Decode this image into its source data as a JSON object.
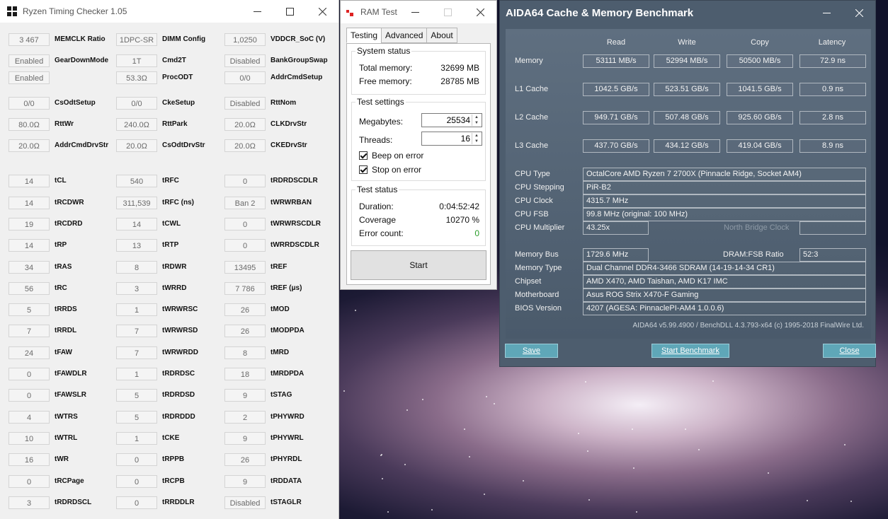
{
  "rtc": {
    "title": "Ryzen Timing Checker 1.05",
    "rows": [
      [
        "3 467",
        "MEMCLK Ratio",
        "1DPC-SR",
        "DIMM Config",
        "1,0250",
        "VDDCR_SoC (V)"
      ],
      [
        "Enabled",
        "GearDownMode",
        "1T",
        "Cmd2T",
        "Disabled",
        "BankGroupSwap"
      ],
      [
        "Enabled",
        "",
        "53.3Ω",
        "ProcODT",
        "0/0",
        "AddrCmdSetup"
      ],
      [
        "0/0",
        "CsOdtSetup",
        "0/0",
        "CkeSetup",
        "Disabled",
        "RttNom"
      ],
      [
        "80.0Ω",
        "RttWr",
        "240.0Ω",
        "RttPark",
        "20.0Ω",
        "CLKDrvStr"
      ],
      [
        "20.0Ω",
        "AddrCmdDrvStr",
        "20.0Ω",
        "CsOdtDrvStr",
        "20.0Ω",
        "CKEDrvStr"
      ],
      [
        "14",
        "tCL",
        "540",
        "tRFC",
        "0",
        "tRDRDSCDLR"
      ],
      [
        "14",
        "tRCDWR",
        "311,539",
        "tRFC (ns)",
        "Ban 2",
        "tWRWRBAN"
      ],
      [
        "19",
        "tRCDRD",
        "14",
        "tCWL",
        "0",
        "tWRWRSCDLR"
      ],
      [
        "14",
        "tRP",
        "13",
        "tRTP",
        "0",
        "tWRRDSCDLR"
      ],
      [
        "34",
        "tRAS",
        "8",
        "tRDWR",
        "13495",
        "tREF"
      ],
      [
        "56",
        "tRC",
        "3",
        "tWRRD",
        "7 786",
        "tREF (μs)"
      ],
      [
        "5",
        "tRRDS",
        "1",
        "tWRWRSC",
        "26",
        "tMOD"
      ],
      [
        "7",
        "tRRDL",
        "7",
        "tWRWRSD",
        "26",
        "tMODPDA"
      ],
      [
        "24",
        "tFAW",
        "7",
        "tWRWRDD",
        "8",
        "tMRD"
      ],
      [
        "0",
        "tFAWDLR",
        "1",
        "tRDRDSC",
        "18",
        "tMRDPDA"
      ],
      [
        "0",
        "tFAWSLR",
        "5",
        "tRDRDSD",
        "9",
        "tSTAG"
      ],
      [
        "4",
        "tWTRS",
        "5",
        "tRDRDDD",
        "2",
        "tPHYWRD"
      ],
      [
        "10",
        "tWTRL",
        "1",
        "tCKE",
        "9",
        "tPHYWRL"
      ],
      [
        "16",
        "tWR",
        "0",
        "tRPPB",
        "26",
        "tPHYRDL"
      ],
      [
        "0",
        "tRCPage",
        "0",
        "tRCPB",
        "9",
        "tRDDATA"
      ],
      [
        "3",
        "tRDRDSCL",
        "0",
        "tRRDDLR",
        "Disabled",
        "tSTAGLR"
      ]
    ]
  },
  "ramtest": {
    "title": "RAM Test",
    "tabs": [
      "Testing",
      "Advanced",
      "About"
    ],
    "system_status": {
      "title": "System status",
      "total_label": "Total memory:",
      "total_value": "32699 MB",
      "free_label": "Free memory:",
      "free_value": "28785 MB"
    },
    "test_settings": {
      "title": "Test settings",
      "megabytes_label": "Megabytes:",
      "megabytes_value": "25534",
      "threads_label": "Threads:",
      "threads_value": "16",
      "beep_label": "Beep on error",
      "stop_label": "Stop on error"
    },
    "test_status": {
      "title": "Test status",
      "duration_label": "Duration:",
      "duration_value": "0:04:52:42",
      "coverage_label": "Coverage",
      "coverage_value": "10270 %",
      "errors_label": "Error count:",
      "errors_value": "0"
    },
    "start_label": "Start",
    "colors": {
      "error_count": "#2a9d2a"
    }
  },
  "aida": {
    "title": "AIDA64 Cache & Memory Benchmark",
    "headers": [
      "Read",
      "Write",
      "Copy",
      "Latency"
    ],
    "bench": [
      {
        "label": "Memory",
        "read": "53111 MB/s",
        "write": "52994 MB/s",
        "copy": "50500 MB/s",
        "latency": "72.9 ns"
      },
      {
        "label": "L1 Cache",
        "read": "1042.5 GB/s",
        "write": "523.51 GB/s",
        "copy": "1041.5 GB/s",
        "latency": "0.9 ns"
      },
      {
        "label": "L2 Cache",
        "read": "949.71 GB/s",
        "write": "507.48 GB/s",
        "copy": "925.60 GB/s",
        "latency": "2.8 ns"
      },
      {
        "label": "L3 Cache",
        "read": "437.70 GB/s",
        "write": "434.12 GB/s",
        "copy": "419.04 GB/s",
        "latency": "8.9 ns"
      }
    ],
    "cpu_type_label": "CPU Type",
    "cpu_type": "OctalCore AMD Ryzen 7 2700X  (Pinnacle Ridge, Socket AM4)",
    "cpu_stepping_label": "CPU Stepping",
    "cpu_stepping": "PiR-B2",
    "cpu_clock_label": "CPU Clock",
    "cpu_clock": "4315.7 MHz",
    "cpu_fsb_label": "CPU FSB",
    "cpu_fsb": "99.8 MHz  (original: 100 MHz)",
    "cpu_mult_label": "CPU Multiplier",
    "cpu_mult": "43.25x",
    "nb_clock_label": "North Bridge Clock",
    "nb_clock": "",
    "mem_bus_label": "Memory Bus",
    "mem_bus": "1729.6 MHz",
    "dram_ratio_label": "DRAM:FSB Ratio",
    "dram_ratio": "52:3",
    "mem_type_label": "Memory Type",
    "mem_type": "Dual Channel DDR4-3466 SDRAM  (14-19-14-34 CR1)",
    "chipset_label": "Chipset",
    "chipset": "AMD X470, AMD Taishan, AMD K17 IMC",
    "mobo_label": "Motherboard",
    "mobo": "Asus ROG Strix X470-F Gaming",
    "bios_label": "BIOS Version",
    "bios": "4207  (AGESA: PinnaclePI-AM4 1.0.0.6)",
    "footer": "AIDA64 v5.99.4900 / BenchDLL 4.3.793-x64  (c) 1995-2018 FinalWire Ltd.",
    "save_label": "Save",
    "start_label": "Start Benchmark",
    "close_label": "Close"
  }
}
